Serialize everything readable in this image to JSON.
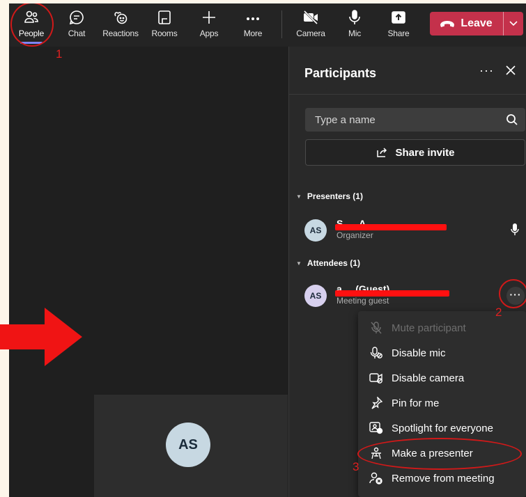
{
  "toolbar": {
    "people": "People",
    "chat": "Chat",
    "reactions": "Reactions",
    "rooms": "Rooms",
    "apps": "Apps",
    "more": "More",
    "camera": "Camera",
    "mic": "Mic",
    "share": "Share",
    "leave": "Leave"
  },
  "panel": {
    "title": "Participants",
    "more": "···",
    "search_placeholder": "Type a name",
    "share_invite": "Share invite",
    "presenters_header": "Presenters (1)",
    "attendees_header": "Attendees (1)",
    "presenter": {
      "initials": "AS",
      "name": "S...., A....",
      "role": "Organizer"
    },
    "attendee": {
      "initials": "AS",
      "name": "a....  (Guest)",
      "role": "Meeting guest"
    }
  },
  "stage": {
    "tile_initials": "AS"
  },
  "menu": {
    "items": [
      {
        "label": "Mute participant",
        "icon": "mic-off-icon",
        "disabled": true
      },
      {
        "label": "Disable mic",
        "icon": "mic-disable-icon"
      },
      {
        "label": "Disable camera",
        "icon": "camera-disable-icon"
      },
      {
        "label": "Pin for me",
        "icon": "pin-icon"
      },
      {
        "label": "Spotlight for everyone",
        "icon": "spotlight-icon"
      },
      {
        "label": "Make a presenter",
        "icon": "presenter-icon"
      },
      {
        "label": "Remove from meeting",
        "icon": "remove-person-icon"
      }
    ]
  },
  "annotations": {
    "step1": "1",
    "step2": "2",
    "step3": "3"
  },
  "colors": {
    "leave": "#c4314b",
    "accent": "#7f85f5",
    "annotation": "#d11919"
  }
}
